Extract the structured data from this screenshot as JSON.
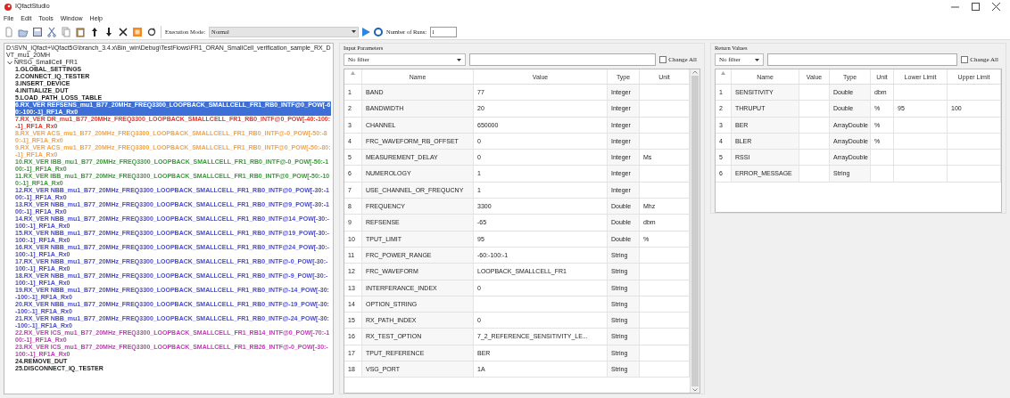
{
  "window": {
    "title": "IQfactStudio"
  },
  "menu": [
    "File",
    "Edit",
    "Tools",
    "Window",
    "Help"
  ],
  "toolbar": {
    "execution_mode_label": "Execution Mode:",
    "execution_mode": "Normal",
    "runs_label": "Number of Runs:",
    "runs": "1"
  },
  "tree": {
    "path": "D:\\SVN_IQfact+\\IQfact5G\\branch_3.4.x\\Bin_win\\Debug\\TestFlows\\FR1_ORAN_SmallCell_verification_sample_RX_DVT_mu1_20MH",
    "root": {
      "label": "NRSG_SmallCell_FR1",
      "expanded": true,
      "children": [
        {
          "label": "1.GLOBAL_SETTINGS",
          "color": "#1f1f1f",
          "selected": false
        },
        {
          "label": "2.CONNECT_IQ_TESTER",
          "color": "#1f1f1f",
          "selected": false
        },
        {
          "label": "3.INSERT_DEVICE",
          "color": "#1f1f1f",
          "selected": false
        },
        {
          "label": "4.INITIALIZE_DUT",
          "color": "#1f1f1f",
          "selected": false
        },
        {
          "label": "5.LOAD_PATH_LOSS_TABLE",
          "color": "#1f1f1f",
          "selected": false
        },
        {
          "label": "6.RX_VER REFSENS_mu1_B77_20MHz_FREQ3300_LOOPBACK_SMALLCELL_FR1_RB0_INTF@0_POW[-60:-100:-1]_RF1A_Rx0",
          "selected": true
        },
        {
          "label": "7.RX_VER DR_mu1_B77_20MHz_FREQ3300_LOOPBACK_SMALLCELL_FR1_RB0_INTF@0_POW[-40:-100:-1]_RF1A_Rx0",
          "color": "#e8372c",
          "selected": false
        },
        {
          "label": "8.RX_VER ACS_mu1_B77_20MHz_FREQ3300_LOOPBACK_SMALLCELL_FR1_RB0_INTF@-0_POW[-50:-80:-1]_RF1A_Rx0",
          "color": "#f5a54a",
          "selected": false
        },
        {
          "label": "9.RX_VER ACS_mu1_B77_20MHz_FREQ3300_LOOPBACK_SMALLCELL_FR1_RB0_INTF@0_POW[-50:-80:-1]_RF1A_Rx0",
          "color": "#f5a54a",
          "selected": false
        },
        {
          "label": "10.RX_VER IBB_mu1_B77_20MHz_FREQ3300_LOOPBACK_SMALLCELL_FR1_RB0_INTF@-0_POW[-50:-100:-1]_RF1A_Rx0",
          "color": "#3a9c3a",
          "selected": false
        },
        {
          "label": "11.RX_VER IBB_mu1_B77_20MHz_FREQ3300_LOOPBACK_SMALLCELL_FR1_RB0_INTF@0_POW[-50:-100:-1]_RF1A_Rx0",
          "color": "#3a9c3a",
          "selected": false
        },
        {
          "label": "12.RX_VER NBB_mu1_B77_20MHz_FREQ3300_LOOPBACK_SMALLCELL_FR1_RB0_INTF@0_POW[-30:-100:-1]_RF1A_Rx0",
          "color": "#4a4ad8",
          "selected": false
        },
        {
          "label": "13.RX_VER NBB_mu1_B77_20MHz_FREQ3300_LOOPBACK_SMALLCELL_FR1_RB0_INTF@9_POW[-30:-100:-1]_RF1A_Rx0",
          "color": "#4a4ad8",
          "selected": false
        },
        {
          "label": "14.RX_VER NBB_mu1_B77_20MHz_FREQ3300_LOOPBACK_SMALLCELL_FR1_RB0_INTF@14_POW[-30:-100:-1]_RF1A_Rx0",
          "color": "#4a4ad8",
          "selected": false
        },
        {
          "label": "15.RX_VER NBB_mu1_B77_20MHz_FREQ3300_LOOPBACK_SMALLCELL_FR1_RB0_INTF@19_POW[-30:-100:-1]_RF1A_Rx0",
          "color": "#4a4ad8",
          "selected": false
        },
        {
          "label": "16.RX_VER NBB_mu1_B77_20MHz_FREQ3300_LOOPBACK_SMALLCELL_FR1_RB0_INTF@24_POW[-30:-100:-1]_RF1A_Rx0",
          "color": "#4a4ad8",
          "selected": false
        },
        {
          "label": "17.RX_VER NBB_mu1_B77_20MHz_FREQ3300_LOOPBACK_SMALLCELL_FR1_RB0_INTF@-0_POW[-30:-100:-1]_RF1A_Rx0",
          "color": "#4a4ad8",
          "selected": false
        },
        {
          "label": "18.RX_VER NBB_mu1_B77_20MHz_FREQ3300_LOOPBACK_SMALLCELL_FR1_RB0_INTF@-9_POW[-30:-100:-1]_RF1A_Rx0",
          "color": "#4a4ad8",
          "selected": false
        },
        {
          "label": "19.RX_VER NBB_mu1_B77_20MHz_FREQ3300_LOOPBACK_SMALLCELL_FR1_RB0_INTF@-14_POW[-30:-100:-1]_RF1A_Rx0",
          "color": "#4a4ad8",
          "selected": false
        },
        {
          "label": "20.RX_VER NBB_mu1_B77_20MHz_FREQ3300_LOOPBACK_SMALLCELL_FR1_RB0_INTF@-19_POW[-30:-100:-1]_RF1A_Rx0",
          "color": "#4a4ad8",
          "selected": false
        },
        {
          "label": "21.RX_VER NBB_mu1_B77_20MHz_FREQ3300_LOOPBACK_SMALLCELL_FR1_RB0_INTF@-24_POW[-30:-100:-1]_RF1A_Rx0",
          "color": "#4a4ad8",
          "selected": false
        },
        {
          "label": "22.RX_VER ICS_mu1_B77_20MHz_FREQ3300_LOOPBACK_SMALLCELL_FR1_RB14_INTF@0_POW[-70:-100:-1]_RF1A_Rx0",
          "color": "#c53ab8",
          "selected": false
        },
        {
          "label": "23.RX_VER ICS_mu1_B77_20MHz_FREQ3300_LOOPBACK_SMALLCELL_FR1_RB26_INTF@-0_POW[-30:-100:-1]_RF1A_Rx0",
          "color": "#c53ab8",
          "selected": false
        },
        {
          "label": "24.REMOVE_DUT",
          "color": "#1f1f1f",
          "selected": false
        },
        {
          "label": "25.DISCONNECT_IQ_TESTER",
          "color": "#1f1f1f",
          "selected": false
        }
      ]
    }
  },
  "input_parameters": {
    "title": "Input Parameters",
    "filter": "No filter",
    "change_all": {
      "label": "Change All",
      "checked": false
    },
    "columns": [
      "Name",
      "Value",
      "Type",
      "Unit"
    ],
    "rows": [
      {
        "index": "1",
        "name": "BAND",
        "value": "77",
        "type": "Integer"
      },
      {
        "index": "2",
        "name": "BANDWIDTH",
        "value": "20",
        "type": "Integer"
      },
      {
        "index": "3",
        "name": "CHANNEL",
        "value": "650000",
        "type": "Integer"
      },
      {
        "index": "4",
        "name": "FRC_WAVEFORM_RB_OFFSET",
        "value": "0",
        "type": "Integer"
      },
      {
        "index": "5",
        "name": "MEASUREMENT_DELAY",
        "value": "0",
        "type": "Integer",
        "unit": "Ms"
      },
      {
        "index": "6",
        "name": "NUMEROLOGY",
        "value": "1",
        "type": "Integer"
      },
      {
        "index": "7",
        "name": "USE_CHANNEL_OR_FREQUCNY",
        "value": "1",
        "type": "Integer"
      },
      {
        "index": "8",
        "name": "FREQUENCY",
        "value": "3300",
        "type": "Double",
        "unit": "Mhz"
      },
      {
        "index": "9",
        "name": "REFSENSE",
        "value": "-65",
        "type": "Double",
        "unit": "dbm"
      },
      {
        "index": "10",
        "name": "TPUT_LIMIT",
        "value": "95",
        "type": "Double",
        "unit": "%"
      },
      {
        "index": "11",
        "name": "FRC_POWER_RANGE",
        "value": "-60:-100:-1",
        "type": "String"
      },
      {
        "index": "12",
        "name": "FRC_WAVEFORM",
        "value": "LOOPBACK_SMALLCELL_FR1",
        "type": "String"
      },
      {
        "index": "13",
        "name": "INTERFERANCE_INDEX",
        "value": "0",
        "type": "String"
      },
      {
        "index": "14",
        "name": "OPTION_STRING",
        "type": "String"
      },
      {
        "index": "15",
        "name": "RX_PATH_INDEX",
        "value": "0",
        "type": "String"
      },
      {
        "index": "16",
        "name": "RX_TEST_OPTION",
        "value": "7_2_REFERENCE_SENSITIVITY_LE...",
        "type": "String"
      },
      {
        "index": "17",
        "name": "TPUT_REFERENCE",
        "value": "BER",
        "type": "String"
      },
      {
        "index": "18",
        "name": "VSG_PORT",
        "value": "1A",
        "type": "String"
      }
    ]
  },
  "return_values": {
    "title": "Return Values",
    "filter": "No filter",
    "change_all": {
      "label": "Change All",
      "checked": false
    },
    "columns": [
      "Name",
      "Value",
      "Type",
      "Unit",
      "Lower Limit",
      "Upper Limit"
    ],
    "rows": [
      {
        "index": "1",
        "name": "SENSITIVITY",
        "type": "Double",
        "unit": "dbm"
      },
      {
        "index": "2",
        "name": "THRUPUT",
        "type": "Double",
        "unit": "%",
        "lower": "95",
        "upper": "100"
      },
      {
        "index": "3",
        "name": "BER",
        "type": "ArrayDouble",
        "unit": "%"
      },
      {
        "index": "4",
        "name": "BLER",
        "type": "ArrayDouble",
        "unit": "%"
      },
      {
        "index": "5",
        "name": "RSSI",
        "type": "ArrayDouble"
      },
      {
        "index": "6",
        "name": "ERROR_MESSAGE",
        "type": "String"
      }
    ]
  }
}
